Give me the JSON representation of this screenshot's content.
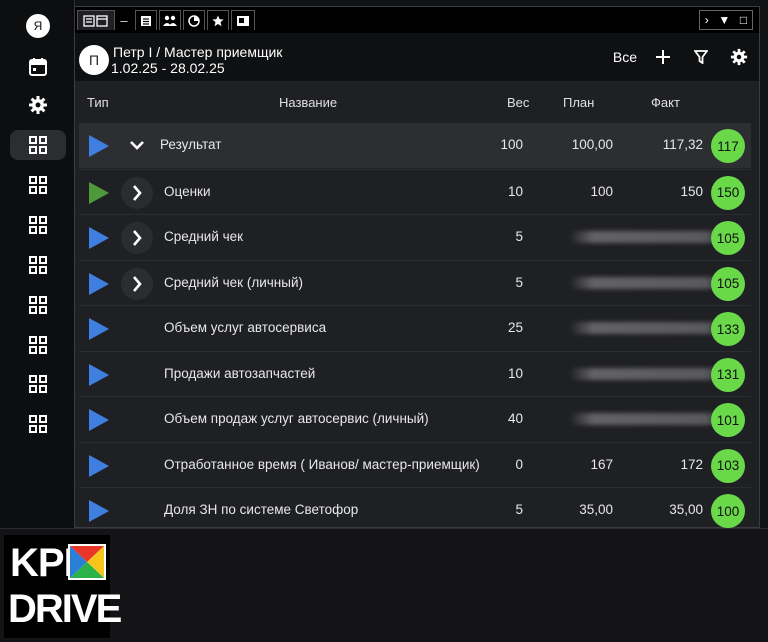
{
  "sidebar": {
    "avatar_letter": "Я",
    "icons": [
      "calendar-icon",
      "gear-icon",
      "grid-icon",
      "grid-icon",
      "grid-icon",
      "grid-icon",
      "grid-icon",
      "grid-icon",
      "grid-icon",
      "grid-icon"
    ]
  },
  "header": {
    "avatar_letter": "П",
    "title": "Петр I / Мастер приемщик",
    "period": "1.02.25 - 28.02.25",
    "filter_label": "Все"
  },
  "table": {
    "columns": {
      "type": "Тип",
      "name": "Название",
      "weight": "Вес",
      "plan": "План",
      "fact": "Факт"
    },
    "rows": [
      {
        "name": "Результат",
        "weight": "100",
        "plan": "100,00",
        "fact": "117,32",
        "score": "117",
        "type_color": "#3f7fe0",
        "expand": "expanded",
        "plan_hidden": false,
        "fact_hidden": false
      },
      {
        "name": "Оценки",
        "weight": "10",
        "plan": "100",
        "fact": "150",
        "score": "150",
        "type_color": "#4e9a3a",
        "expand": "collapsed",
        "plan_hidden": false,
        "fact_hidden": false
      },
      {
        "name": "Средний чек",
        "weight": "5",
        "plan": "",
        "fact": "",
        "score": "105",
        "type_color": "#3f7fe0",
        "expand": "collapsed",
        "plan_hidden": true,
        "fact_hidden": true
      },
      {
        "name": "Средний чек (личный)",
        "weight": "5",
        "plan": "",
        "fact": "",
        "score": "105",
        "type_color": "#3f7fe0",
        "expand": "collapsed",
        "plan_hidden": true,
        "fact_hidden": true
      },
      {
        "name": "Объем услуг автосервиса",
        "weight": "25",
        "plan": "",
        "fact": "",
        "score": "133",
        "type_color": "#3f7fe0",
        "expand": "none",
        "plan_hidden": true,
        "fact_hidden": true
      },
      {
        "name": "Продажи автозапчастей",
        "weight": "10",
        "plan": "",
        "fact": "",
        "score": "131",
        "type_color": "#3f7fe0",
        "expand": "none",
        "plan_hidden": true,
        "fact_hidden": true
      },
      {
        "name": "Объем продаж услуг автосервис (личный)",
        "weight": "40",
        "plan": "",
        "fact": "",
        "score": "101",
        "type_color": "#3f7fe0",
        "expand": "none",
        "plan_hidden": true,
        "fact_hidden": true
      },
      {
        "name": "Отработанное время ( Иванов/ мастер-приемщик)",
        "weight": "0",
        "plan": "167",
        "fact": "172",
        "score": "103",
        "type_color": "#3f7fe0",
        "expand": "none",
        "plan_hidden": false,
        "fact_hidden": false
      },
      {
        "name": "Доля ЗН по системе Светофор",
        "weight": "5",
        "plan": "35,00",
        "fact": "35,00",
        "score": "100",
        "type_color": "#3f7fe0",
        "expand": "none",
        "plan_hidden": false,
        "fact_hidden": false
      }
    ]
  },
  "logo": {
    "line1": "KPI",
    "line2": "DRIVE"
  },
  "colors": {
    "score_badge": "#69d94a",
    "type_blue": "#3f7fe0",
    "type_green": "#4e9a3a"
  }
}
